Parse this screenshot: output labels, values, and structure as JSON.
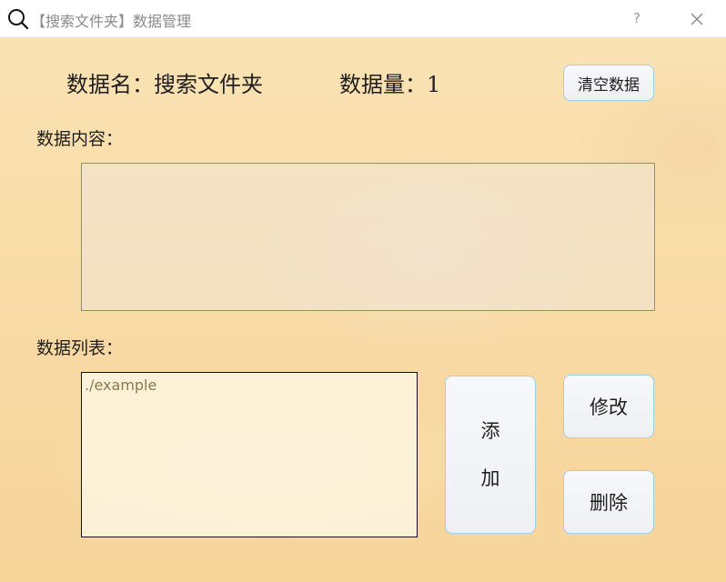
{
  "window": {
    "title": "【搜索文件夹】数据管理",
    "help_label": "?",
    "icons": {
      "app": "search-icon",
      "close": "close-icon"
    }
  },
  "header": {
    "name_label": "数据名：搜索文件夹",
    "count_label": "数据量：1",
    "clear_button": "清空数据"
  },
  "content": {
    "label": "数据内容：",
    "text": ""
  },
  "list": {
    "label": "数据列表：",
    "items": [
      "./example"
    ]
  },
  "actions": {
    "add_line1": "添",
    "add_line2": "加",
    "edit": "修改",
    "delete": "删除"
  },
  "colors": {
    "button_border": "#9fd0e6",
    "background": "#f9deaa"
  }
}
